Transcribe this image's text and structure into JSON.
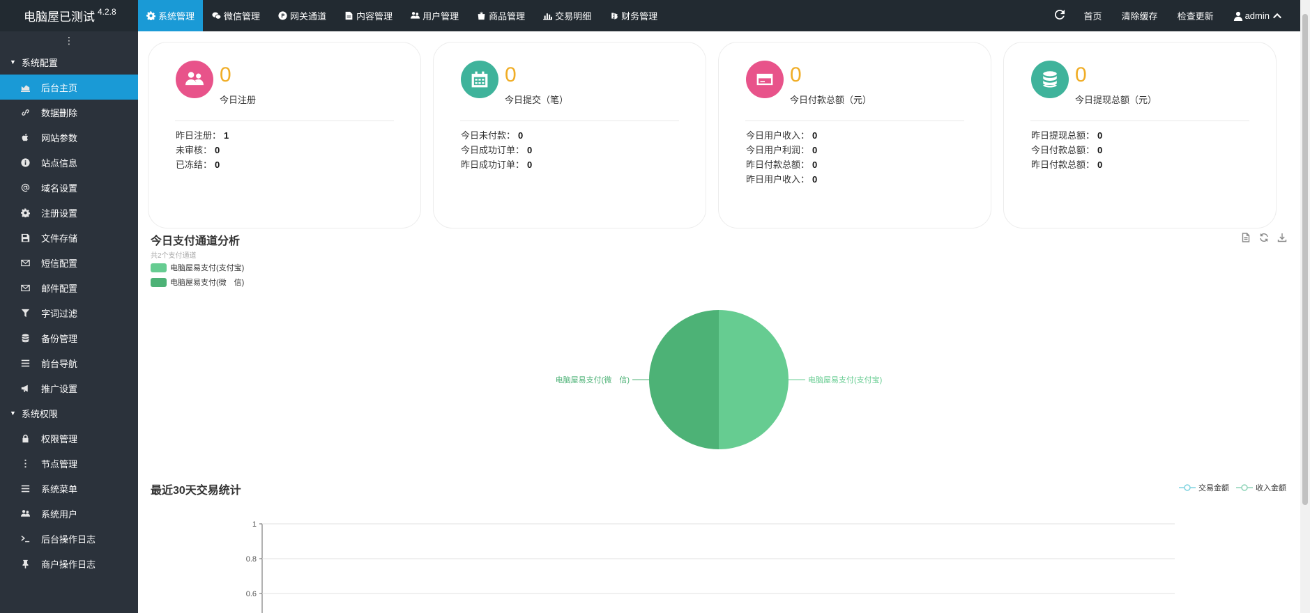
{
  "brand": {
    "title": "电脑屋已测试",
    "version": "4.2.8"
  },
  "sidebar": {
    "toggle": "⋮",
    "groups": [
      {
        "label": "系统配置",
        "items": [
          {
            "label": "后台主页",
            "icon": "area-chart-icon"
          },
          {
            "label": "数据删除",
            "icon": "chain-icon"
          },
          {
            "label": "网站参数",
            "icon": "apple-icon"
          },
          {
            "label": "站点信息",
            "icon": "info-icon"
          },
          {
            "label": "域名设置",
            "icon": "at-icon"
          },
          {
            "label": "注册设置",
            "icon": "gear-icon"
          },
          {
            "label": "文件存储",
            "icon": "floppy-icon"
          },
          {
            "label": "短信配置",
            "icon": "envelope-icon"
          },
          {
            "label": "邮件配置",
            "icon": "envelope-icon"
          },
          {
            "label": "字词过滤",
            "icon": "filter-icon"
          },
          {
            "label": "备份管理",
            "icon": "database-icon"
          },
          {
            "label": "前台导航",
            "icon": "bars-icon"
          },
          {
            "label": "推广设置",
            "icon": "bullhorn-icon"
          }
        ]
      },
      {
        "label": "系统权限",
        "items": [
          {
            "label": "权限管理",
            "icon": "lock-icon"
          },
          {
            "label": "节点管理",
            "icon": "ellipsis-icon"
          },
          {
            "label": "系统菜单",
            "icon": "bars-icon"
          },
          {
            "label": "系统用户",
            "icon": "users-icon"
          },
          {
            "label": "后台操作日志",
            "icon": "terminal-icon"
          },
          {
            "label": "商户操作日志",
            "icon": "pin-icon"
          }
        ]
      }
    ]
  },
  "topbar": {
    "tabs": [
      {
        "label": "系统管理",
        "icon": "gear-icon"
      },
      {
        "label": "微信管理",
        "icon": "wechat-icon"
      },
      {
        "label": "网关通道",
        "icon": "product-hunt-icon"
      },
      {
        "label": "内容管理",
        "icon": "file-icon"
      },
      {
        "label": "用户管理",
        "icon": "users-icon"
      },
      {
        "label": "商品管理",
        "icon": "shopping-bag-icon"
      },
      {
        "label": "交易明细",
        "icon": "bar-chart-icon"
      },
      {
        "label": "财务管理",
        "icon": "money-icon"
      }
    ],
    "right": {
      "refresh_icon": "refresh-icon",
      "home": "首页",
      "clear_cache": "清除缓存",
      "check_update": "检查更新",
      "user": "admin",
      "user_icon": "user-icon",
      "chevron_icon": "chevron-up-icon"
    }
  },
  "cards": [
    {
      "value": "0",
      "label": "今日注册",
      "color": "#e8538a",
      "icon": "users-icon",
      "stats": [
        {
          "k": "昨日注册：",
          "v": "1"
        },
        {
          "k": "未审核：",
          "v": "0"
        },
        {
          "k": "已冻结：",
          "v": "0"
        }
      ]
    },
    {
      "value": "0",
      "label": "今日提交（笔）",
      "color": "#3fb39b",
      "icon": "calendar-icon",
      "stats": [
        {
          "k": "今日未付款：",
          "v": "0"
        },
        {
          "k": "今日成功订单：",
          "v": "0"
        },
        {
          "k": "昨日成功订单：",
          "v": "0"
        }
      ]
    },
    {
      "value": "0",
      "label": "今日付款总额（元）",
      "color": "#e8538a",
      "icon": "credit-card-icon",
      "stats": [
        {
          "k": "今日用户收入：",
          "v": "0"
        },
        {
          "k": "今日用户利润：",
          "v": "0"
        },
        {
          "k": "昨日付款总额：",
          "v": "0"
        },
        {
          "k": "昨日用户收入：",
          "v": "0"
        }
      ]
    },
    {
      "value": "0",
      "label": "今日提现总额（元）",
      "color": "#3fb39b",
      "icon": "database-icon",
      "stats": [
        {
          "k": "昨日提现总额：",
          "v": "0"
        },
        {
          "k": "今日付款总额：",
          "v": "0"
        },
        {
          "k": "昨日付款总额：",
          "v": "0"
        }
      ]
    }
  ],
  "pie_section": {
    "title": "今日支付通道分析",
    "subtitle": "共2个支付通道",
    "tools": [
      "file-text-icon",
      "refresh-icon",
      "download-icon"
    ]
  },
  "line_section": {
    "title": "最近30天交易统计"
  },
  "chart_data": [
    {
      "type": "pie",
      "title": "今日支付通道分析",
      "subtitle": "共2个支付通道",
      "legend_position": "top-left",
      "labels": [
        "电脑屋易支付(支付宝)",
        "电脑屋易支付(微　信)"
      ],
      "values": [
        1,
        1
      ],
      "colors": [
        "#66cc91",
        "#4db276"
      ]
    },
    {
      "type": "line",
      "title": "最近30天交易统计",
      "legend_position": "top-right",
      "series": [
        {
          "name": "交易金额",
          "values": [],
          "color": "#7fd3e0"
        },
        {
          "name": "收入金额",
          "values": [],
          "color": "#8ed4b8"
        }
      ],
      "y_ticks": [
        "1",
        "0.8",
        "0.6"
      ],
      "ylim": [
        0,
        1
      ],
      "grid": true
    }
  ],
  "colors": {
    "accent": "#1a9ad6",
    "sidebar_bg": "#2b323b",
    "topbar_bg": "#222a31",
    "number": "#f0ad26"
  }
}
